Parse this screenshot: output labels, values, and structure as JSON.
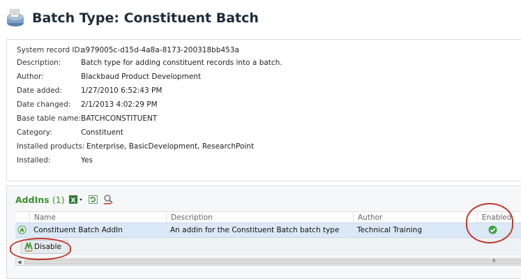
{
  "header": {
    "title": "Batch Type: Constituent Batch",
    "icon": "batch-type-icon"
  },
  "details": {
    "rows": [
      {
        "label": "System record ID:",
        "value": "a979005c-d15d-4a8a-8173-200318bb453a"
      },
      {
        "label": "Description:",
        "value": "Batch type for adding constituent records into a batch."
      },
      {
        "label": "Author:",
        "value": "Blackbaud Product Development"
      },
      {
        "label": "Date added:",
        "value": "1/27/2010 6:52:43 PM"
      },
      {
        "label": "Date changed:",
        "value": "2/1/2013 4:02:29 PM"
      },
      {
        "label": "Base table name:",
        "value": "BATCHCONSTITUENT"
      },
      {
        "label": "Category:",
        "value": "Constituent"
      },
      {
        "label": "Installed products:",
        "value": "Enterprise, BasicDevelopment, ResearchPoint"
      },
      {
        "label": "Installed:",
        "value": "Yes"
      }
    ]
  },
  "addins": {
    "title": "AddIns",
    "count": "(1)",
    "toolbar_icons": [
      "excel-export-icon",
      "refresh-icon",
      "filter-icon"
    ],
    "columns": [
      "Name",
      "Description",
      "Author",
      "Enabled"
    ],
    "rows": [
      {
        "name": "Constituent Batch AddIn",
        "description": "An addin for the Constituent Batch batch type",
        "author": "Technical Training",
        "enabled": true
      }
    ],
    "actions": {
      "disable_label": "Disable"
    },
    "scrollbar_grip": "III"
  },
  "colors": {
    "annotation": "#c0392b",
    "title_green": "#3e8e2e",
    "row_selected": "#dbe8f7"
  }
}
